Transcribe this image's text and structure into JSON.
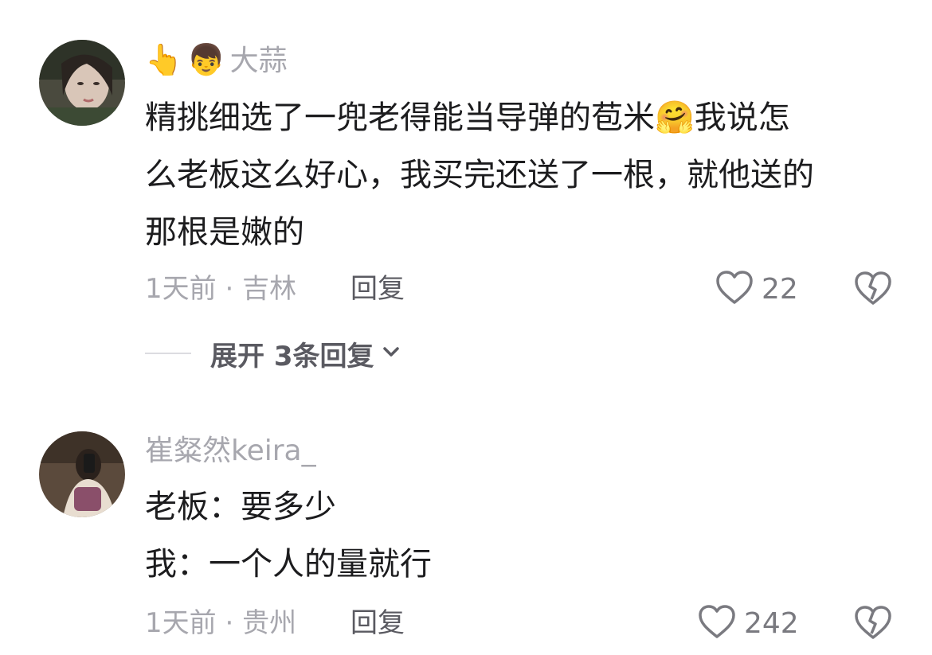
{
  "comments": [
    {
      "username": "大蒜",
      "username_emojis": [
        "👆",
        "👦"
      ],
      "text_lines": [
        "精挑细选了一兜老得能当导弹的苞米🤗我说怎",
        "么老板这么好心，我买完还送了一根，就他送的",
        "那根是嫩的"
      ],
      "time": "1天前",
      "location": "吉林",
      "reply_label": "回复",
      "likes": "22",
      "expand_label": "展开 3条回复"
    },
    {
      "username": "崔粲然keira_",
      "text_lines": [
        "老板：要多少",
        "我：一个人的量就行"
      ],
      "time": "1天前",
      "location": "贵州",
      "reply_label": "回复",
      "likes": "242"
    }
  ],
  "icons": {
    "like": "heart-outline-icon",
    "dislike": "broken-heart-icon",
    "expand": "chevron-down-icon"
  },
  "colors": {
    "text": "#1c1c1e",
    "muted": "#a7a7ae",
    "action": "#5a5a61"
  }
}
